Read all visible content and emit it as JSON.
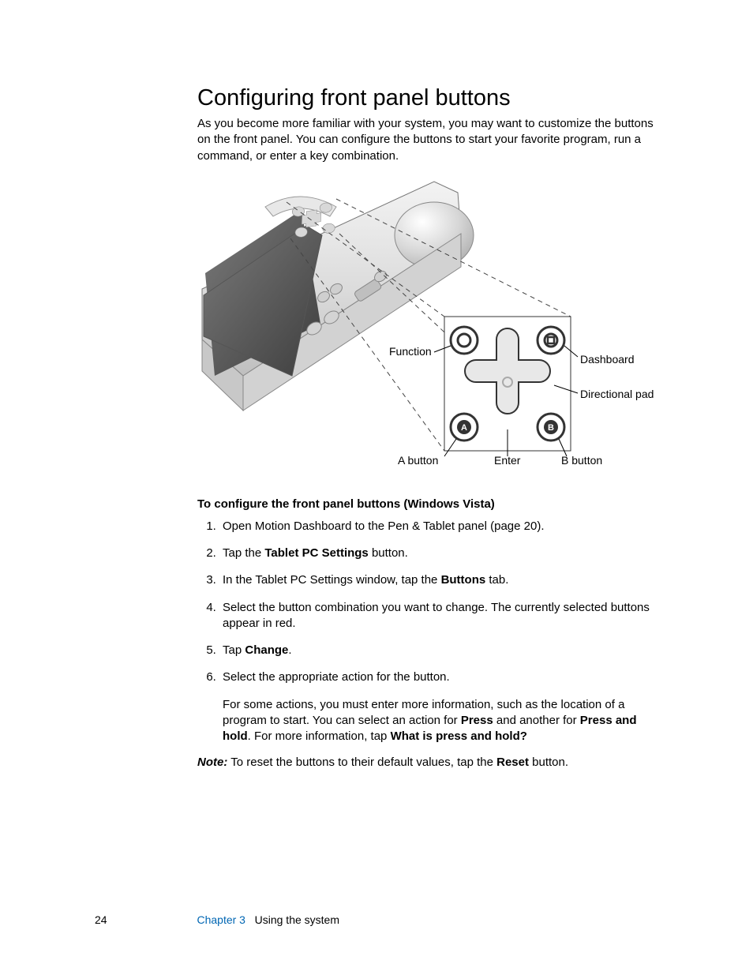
{
  "title": "Configuring front panel buttons",
  "intro": "As you become more familiar with your system, you may want to customize the buttons on the front panel. You can configure the buttons to start your favorite program, run a command, or enter a key combination.",
  "labels": {
    "function": "Function",
    "dashboard": "Dashboard",
    "dpad": "Directional pad",
    "a_button": "A button",
    "enter": "Enter",
    "b_button": "B button",
    "glyph_a": "A",
    "glyph_b": "B"
  },
  "subhead": "To configure the front panel buttons (Windows Vista)",
  "steps": {
    "s1": "Open Motion Dashboard to the Pen & Tablet panel (page 20).",
    "s2_a": "Tap the ",
    "s2_b": "Tablet PC Settings",
    "s2_c": " button.",
    "s3_a": "In the Tablet PC Settings window, tap the ",
    "s3_b": "Buttons",
    "s3_c": " tab.",
    "s4": "Select the button combination you want to change. The currently selected buttons appear in red.",
    "s5_a": "Tap ",
    "s5_b": "Change",
    "s5_c": ".",
    "s6_a": "Select the appropriate action for the button.",
    "s6_extra_a": "For some actions, you must enter more information, such as the location of a program to start. You can select an action for ",
    "s6_extra_b": "Press",
    "s6_extra_c": " and another for ",
    "s6_extra_d": "Press and hold",
    "s6_extra_e": ". For more information, tap ",
    "s6_extra_f": "What is press and hold?"
  },
  "note": {
    "label": "Note:",
    "a": " To reset the buttons to their default values, tap the ",
    "b": "Reset",
    "c": " button."
  },
  "footer": {
    "page": "24",
    "chapter": "Chapter 3",
    "section": "Using the system"
  }
}
